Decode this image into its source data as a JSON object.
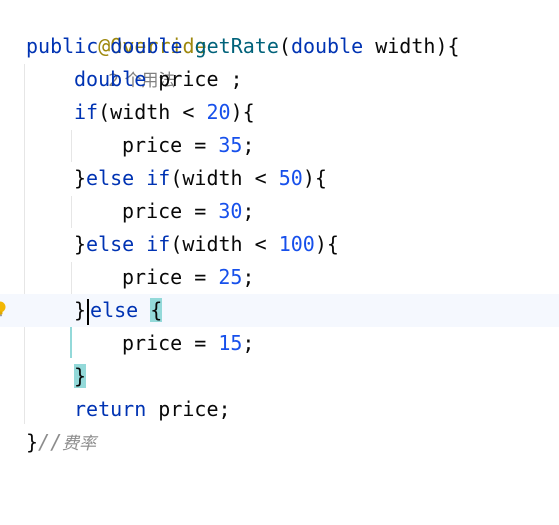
{
  "editor": {
    "annotation": "@Override",
    "usages_hint": "2 个用法",
    "signature": {
      "kw_public": "public",
      "kw_double": "double",
      "method_name": "getRate",
      "param_open": "(",
      "param_type": "double",
      "param_name": " width",
      "param_close": "){"
    },
    "decl": {
      "type": "double",
      "rest": " price ;"
    },
    "if1": {
      "kw": "if",
      "cond": "(width < ",
      "limit": "20",
      "close": "){"
    },
    "assign1": {
      "text": "price = ",
      "value": "35",
      "semi": ";"
    },
    "elseif1": {
      "close_brace": "}",
      "kw_else": "else",
      "kw_if": " if",
      "cond": "(width < ",
      "limit": "50",
      "close": "){"
    },
    "assign2": {
      "text": "price = ",
      "value": "30",
      "semi": ";"
    },
    "elseif2": {
      "close_brace": "}",
      "kw_else": "else",
      "kw_if": " if",
      "cond": "(width < ",
      "limit": "100",
      "close": "){"
    },
    "assign3": {
      "text": "price = ",
      "value": "25",
      "semi": ";"
    },
    "else": {
      "close_brace": "}",
      "kw_else": "else",
      "open_brace": "{"
    },
    "assign4": {
      "text": "price = ",
      "value": "15",
      "semi": ";"
    },
    "else_close": "}",
    "return_stmt": {
      "kw": "return",
      "rest": " price;"
    },
    "method_close": "}",
    "comment_slashes": "//",
    "comment_text": "费率"
  },
  "colors": {
    "keyword": "#0033b3",
    "method": "#00627a",
    "number": "#1750eb",
    "annotation": "#9e880d",
    "comment": "#8c8c8c",
    "brace_match": "#93d9d9",
    "current_line": "#f5f8fe"
  },
  "icons": {
    "intention_bulb": "lightbulb-icon"
  }
}
